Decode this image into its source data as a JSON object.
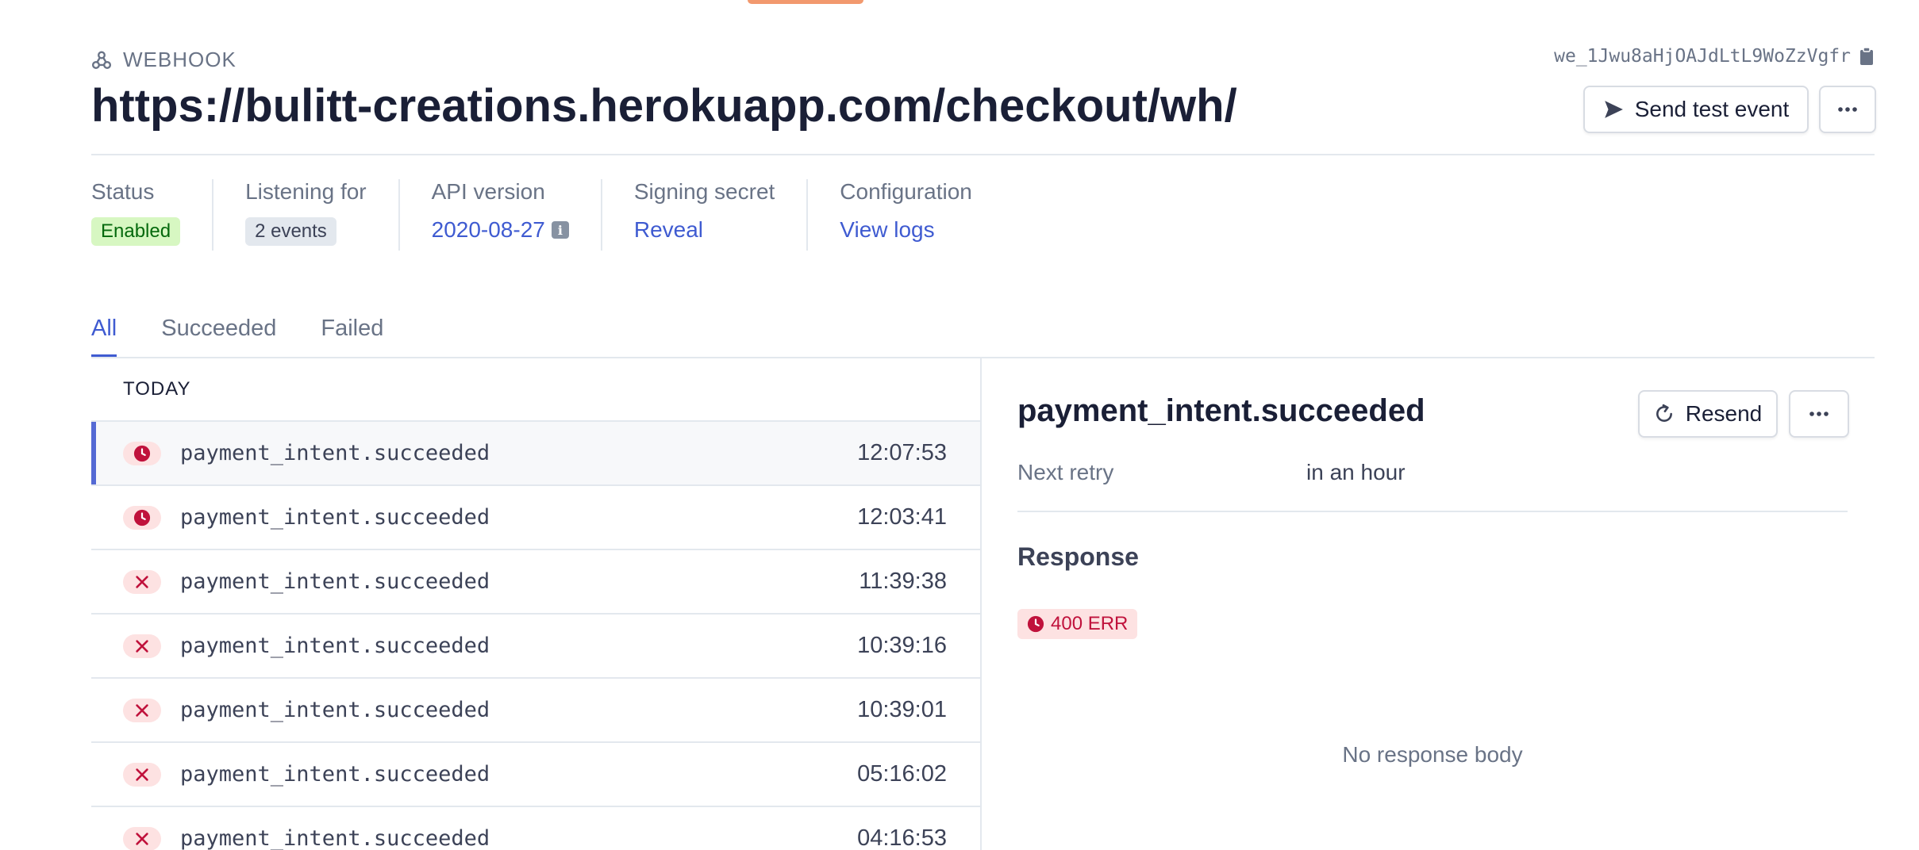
{
  "header": {
    "kind_label": "WEBHOOK",
    "url": "https://bulitt-creations.herokuapp.com/checkout/wh/",
    "webhook_id": "we_1Jwu8aHjOAJdLtL9WoZzVgfr",
    "send_test_label": "Send test event"
  },
  "meta": {
    "status": {
      "label": "Status",
      "value": "Enabled"
    },
    "listening": {
      "label": "Listening for",
      "value": "2 events"
    },
    "api": {
      "label": "API version",
      "value": "2020-08-27"
    },
    "secret": {
      "label": "Signing secret",
      "value": "Reveal"
    },
    "config": {
      "label": "Configuration",
      "value": "View logs"
    }
  },
  "tabs": [
    {
      "label": "All",
      "active": true
    },
    {
      "label": "Succeeded",
      "active": false
    },
    {
      "label": "Failed",
      "active": false
    }
  ],
  "list": {
    "group_label": "TODAY",
    "rows": [
      {
        "event": "payment_intent.succeeded",
        "time": "12:07:53",
        "status": "pending",
        "selected": true
      },
      {
        "event": "payment_intent.succeeded",
        "time": "12:03:41",
        "status": "pending",
        "selected": false
      },
      {
        "event": "payment_intent.succeeded",
        "time": "11:39:38",
        "status": "failed",
        "selected": false
      },
      {
        "event": "payment_intent.succeeded",
        "time": "10:39:16",
        "status": "failed",
        "selected": false
      },
      {
        "event": "payment_intent.succeeded",
        "time": "10:39:01",
        "status": "failed",
        "selected": false
      },
      {
        "event": "payment_intent.succeeded",
        "time": "05:16:02",
        "status": "failed",
        "selected": false
      },
      {
        "event": "payment_intent.succeeded",
        "time": "04:16:53",
        "status": "failed",
        "selected": false
      }
    ]
  },
  "detail": {
    "title": "payment_intent.succeeded",
    "resend_label": "Resend",
    "retry_label": "Next retry",
    "retry_value": "in an hour",
    "response_title": "Response",
    "response_code": "400 ERR",
    "no_body": "No response body"
  },
  "colors": {
    "accent": "#3f5bd1",
    "error": "#c0123c",
    "success": "#05690d",
    "top_accent": "#f2996e"
  },
  "icons": {
    "kind": "webhook-icon",
    "copy": "clipboard-icon",
    "send": "send-arrow-icon",
    "more": "ellipsis-icon",
    "info": "info-icon",
    "resend": "refresh-icon",
    "pending": "clock-icon",
    "failed": "x-icon"
  }
}
